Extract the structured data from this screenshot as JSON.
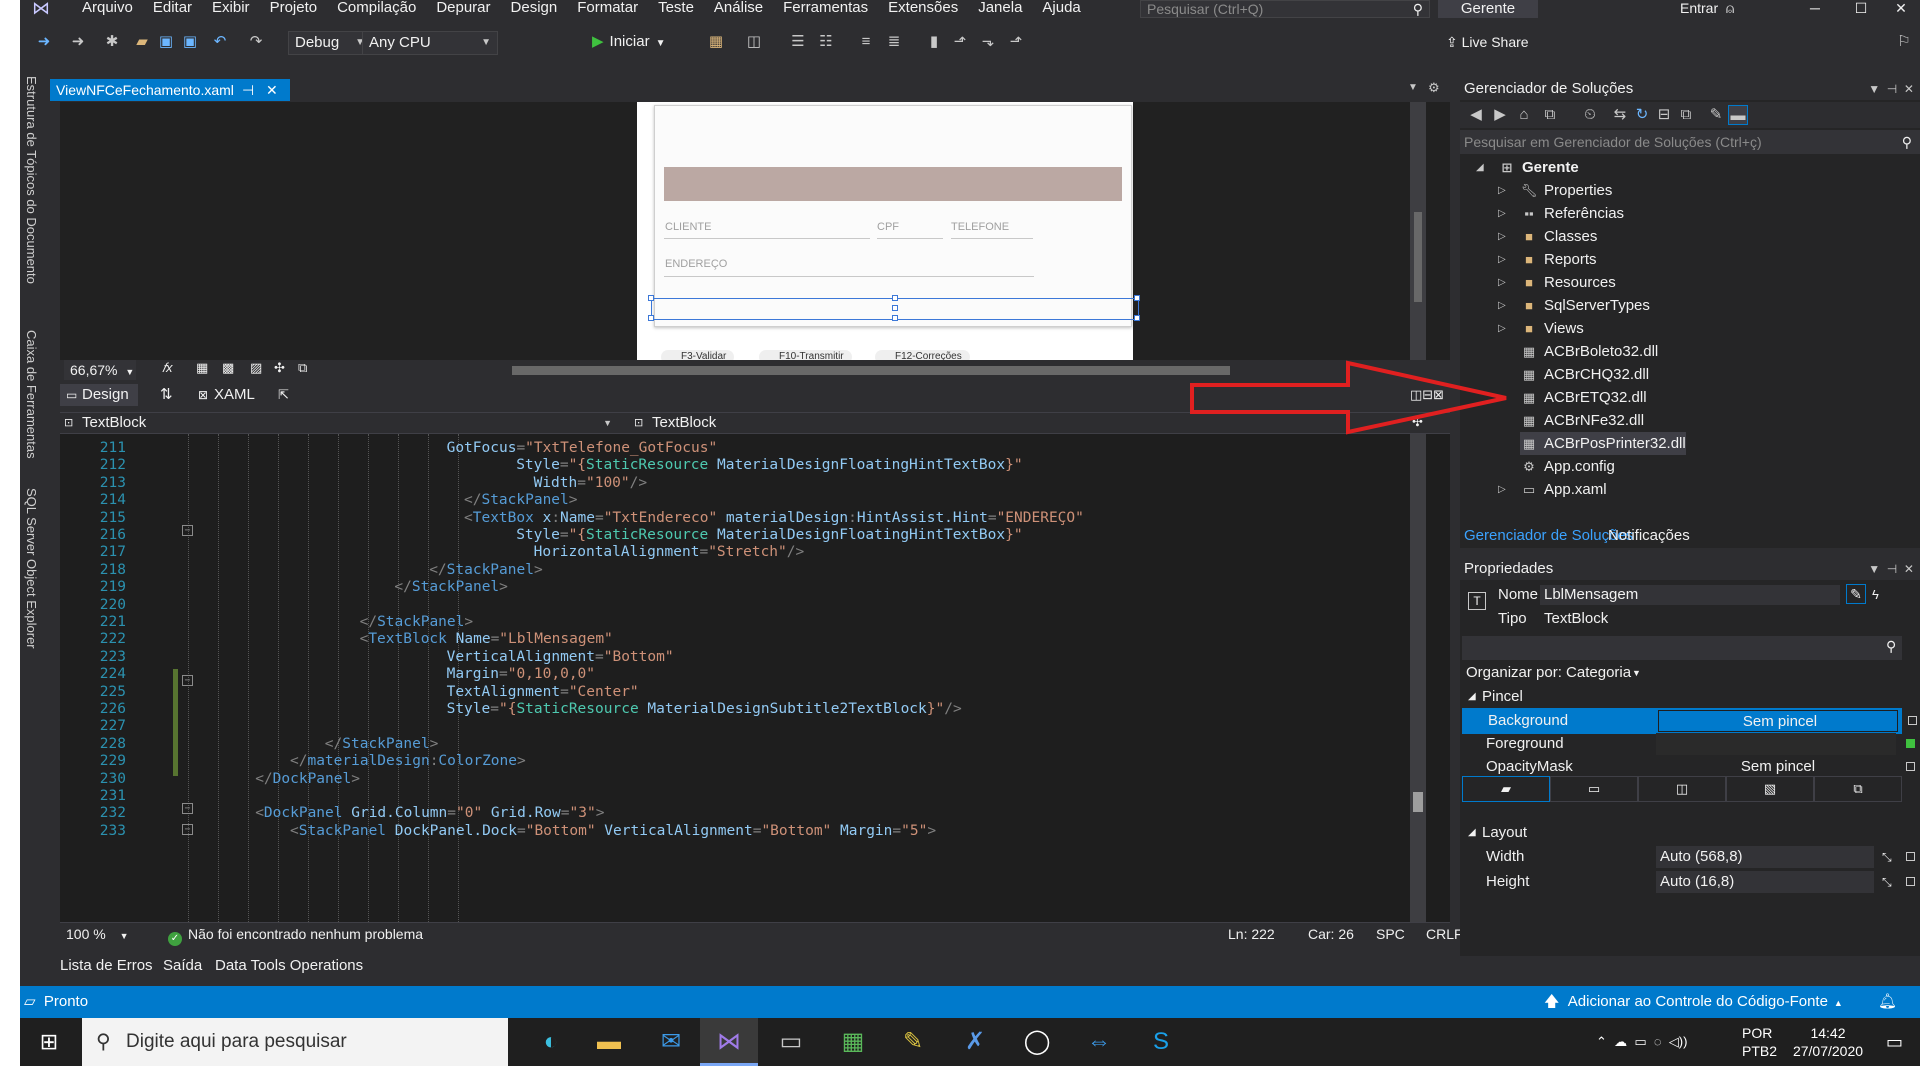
{
  "menu": {
    "items": [
      "Arquivo",
      "Editar",
      "Exibir",
      "Projeto",
      "Compilação",
      "Depurar",
      "Design",
      "Formatar",
      "Teste",
      "Análise",
      "Ferramentas",
      "Extensões",
      "Janela",
      "Ajuda"
    ],
    "search_placeholder": "Pesquisar (Ctrl+Q)",
    "solution_name": "Gerente",
    "sign_in": "Entrar"
  },
  "toolbar": {
    "config": "Debug",
    "platform": "Any CPU",
    "start_label": "Iniciar",
    "live_share": "Live Share"
  },
  "side_tabs": [
    "Estrutura de Tópicos do Documento",
    "Caixa de Ferramentas",
    "SQL Server Object Explorer"
  ],
  "document_tab": {
    "title": "ViewNFCeFechamento.xaml"
  },
  "designer": {
    "fields": {
      "cliente": "CLIENTE",
      "cpf": "CPF",
      "telefone": "TELEFONE",
      "endereco": "ENDEREÇO"
    },
    "buttons": [
      "F3-Validar",
      "F10-Transmitir",
      "F12-Correções"
    ],
    "zoom": "66,67%"
  },
  "split_tabs": {
    "design": "Design",
    "xaml": "XAML"
  },
  "breadcrumb": {
    "left": "TextBlock",
    "right": "TextBlock"
  },
  "code_lines": [
    {
      "n": "211",
      "indent": 38,
      "parts": [
        [
          "attr",
          "GotFocus"
        ],
        [
          "br",
          "="
        ],
        [
          "str",
          "\"TxtTelefone_GotFocus\""
        ]
      ]
    },
    {
      "n": "212",
      "indent": 46,
      "parts": [
        [
          "attr",
          "Style"
        ],
        [
          "br",
          "="
        ],
        [
          "str",
          "\"{"
        ],
        [
          "res",
          "StaticResource "
        ],
        [
          "attr",
          "MaterialDesignFloatingHintTextBox"
        ],
        [
          "str",
          "}\""
        ]
      ]
    },
    {
      "n": "213",
      "indent": 48,
      "parts": [
        [
          "attr",
          "Width"
        ],
        [
          "br",
          "="
        ],
        [
          "str",
          "\"100\""
        ],
        [
          "br",
          "/>"
        ]
      ]
    },
    {
      "n": "214",
      "indent": 40,
      "parts": [
        [
          "br",
          "</"
        ],
        [
          "tag",
          "StackPanel"
        ],
        [
          "br",
          ">"
        ]
      ]
    },
    {
      "n": "215",
      "indent": 40,
      "parts": [
        [
          "br",
          "<"
        ],
        [
          "tag",
          "TextBox "
        ],
        [
          "attr",
          "x"
        ],
        [
          "br",
          ":"
        ],
        [
          "attr",
          "Name"
        ],
        [
          "br",
          "="
        ],
        [
          "str",
          "\"TxtEndereco\" "
        ],
        [
          "attr",
          "materialDesign"
        ],
        [
          "br",
          ":"
        ],
        [
          "attr",
          "HintAssist.Hint"
        ],
        [
          "br",
          "="
        ],
        [
          "str",
          "\"ENDEREÇO\""
        ]
      ]
    },
    {
      "n": "216",
      "indent": 46,
      "parts": [
        [
          "attr",
          "Style"
        ],
        [
          "br",
          "="
        ],
        [
          "str",
          "\"{"
        ],
        [
          "res",
          "StaticResource "
        ],
        [
          "attr",
          "MaterialDesignFloatingHintTextBox"
        ],
        [
          "str",
          "}\""
        ]
      ]
    },
    {
      "n": "217",
      "indent": 48,
      "parts": [
        [
          "attr",
          "HorizontalAlignment"
        ],
        [
          "br",
          "="
        ],
        [
          "str",
          "\"Stretch\""
        ],
        [
          "br",
          "/>"
        ]
      ]
    },
    {
      "n": "218",
      "indent": 36,
      "parts": [
        [
          "br",
          "</"
        ],
        [
          "tag",
          "StackPanel"
        ],
        [
          "br",
          ">"
        ]
      ]
    },
    {
      "n": "219",
      "indent": 32,
      "parts": [
        [
          "br",
          "</"
        ],
        [
          "tag",
          "StackPanel"
        ],
        [
          "br",
          ">"
        ]
      ]
    },
    {
      "n": "220",
      "indent": 0,
      "parts": []
    },
    {
      "n": "221",
      "indent": 28,
      "parts": [
        [
          "br",
          "</"
        ],
        [
          "tag",
          "StackPanel"
        ],
        [
          "br",
          ">"
        ]
      ]
    },
    {
      "n": "222",
      "indent": 28,
      "parts": [
        [
          "br",
          "<"
        ],
        [
          "tag",
          "TextBlock "
        ],
        [
          "attr",
          "Name"
        ],
        [
          "br",
          "="
        ],
        [
          "str",
          "\"LblMensagem\""
        ]
      ]
    },
    {
      "n": "223",
      "indent": 38,
      "parts": [
        [
          "attr",
          "VerticalAlignment"
        ],
        [
          "br",
          "="
        ],
        [
          "str",
          "\"Bottom\""
        ]
      ]
    },
    {
      "n": "224",
      "indent": 38,
      "parts": [
        [
          "attr",
          "Margin"
        ],
        [
          "br",
          "="
        ],
        [
          "str",
          "\"0,10,0,0\""
        ]
      ]
    },
    {
      "n": "225",
      "indent": 38,
      "parts": [
        [
          "attr",
          "TextAlignment"
        ],
        [
          "br",
          "="
        ],
        [
          "str",
          "\"Center\""
        ]
      ]
    },
    {
      "n": "226",
      "indent": 38,
      "parts": [
        [
          "attr",
          "Style"
        ],
        [
          "br",
          "="
        ],
        [
          "str",
          "\"{"
        ],
        [
          "res",
          "StaticResource "
        ],
        [
          "attr",
          "MaterialDesignSubtitle2TextBlock"
        ],
        [
          "str",
          "}\""
        ],
        [
          "br",
          "/>"
        ]
      ]
    },
    {
      "n": "227",
      "indent": 0,
      "parts": []
    },
    {
      "n": "228",
      "indent": 24,
      "parts": [
        [
          "br",
          "</"
        ],
        [
          "tag",
          "StackPanel"
        ],
        [
          "br",
          ">"
        ]
      ]
    },
    {
      "n": "229",
      "indent": 20,
      "parts": [
        [
          "br",
          "</"
        ],
        [
          "tag",
          "materialDesign"
        ],
        [
          "br",
          ":"
        ],
        [
          "tag",
          "ColorZone"
        ],
        [
          "br",
          ">"
        ]
      ]
    },
    {
      "n": "230",
      "indent": 16,
      "parts": [
        [
          "br",
          "</"
        ],
        [
          "tag",
          "DockPanel"
        ],
        [
          "br",
          ">"
        ]
      ]
    },
    {
      "n": "231",
      "indent": 0,
      "parts": []
    },
    {
      "n": "232",
      "indent": 16,
      "parts": [
        [
          "br",
          "<"
        ],
        [
          "tag",
          "DockPanel "
        ],
        [
          "attr",
          "Grid.Column"
        ],
        [
          "br",
          "="
        ],
        [
          "str",
          "\"0\" "
        ],
        [
          "attr",
          "Grid.Row"
        ],
        [
          "br",
          "="
        ],
        [
          "str",
          "\"3\""
        ],
        [
          "br",
          ">"
        ]
      ]
    },
    {
      "n": "233",
      "indent": 20,
      "parts": [
        [
          "br",
          "<"
        ],
        [
          "tag",
          "StackPanel "
        ],
        [
          "attr",
          "DockPanel.Dock"
        ],
        [
          "br",
          "="
        ],
        [
          "str",
          "\"Bottom\" "
        ],
        [
          "attr",
          "VerticalAlignment"
        ],
        [
          "br",
          "="
        ],
        [
          "str",
          "\"Bottom\" "
        ],
        [
          "attr",
          "Margin"
        ],
        [
          "br",
          "="
        ],
        [
          "str",
          "\"5\""
        ],
        [
          "br",
          ">"
        ]
      ]
    }
  ],
  "editor_status": {
    "zoom": "100 %",
    "issues": "Não foi encontrado nenhum problema",
    "line": "Ln: 222",
    "col": "Car: 26",
    "spc": "SPC",
    "crlf": "CRLF"
  },
  "bottom_tabs": [
    "Lista de Erros",
    "Saída",
    "Data Tools Operations"
  ],
  "status_bar": {
    "ready": "Pronto",
    "source_control": "Adicionar ao Controle do Código-Fonte"
  },
  "solution_explorer": {
    "title": "Gerenciador de Soluções",
    "search_placeholder": "Pesquisar em Gerenciador de Soluções (Ctrl+ç)",
    "project": "Gerente",
    "items": [
      {
        "label": "Properties",
        "icon": "wrench",
        "expandable": true
      },
      {
        "label": "Referências",
        "icon": "references",
        "expandable": true
      },
      {
        "label": "Classes",
        "icon": "folder",
        "expandable": true
      },
      {
        "label": "Reports",
        "icon": "folder",
        "expandable": true
      },
      {
        "label": "Resources",
        "icon": "folder",
        "expandable": true
      },
      {
        "label": "SqlServerTypes",
        "icon": "folder",
        "expandable": true
      },
      {
        "label": "Views",
        "icon": "folder",
        "expandable": true
      },
      {
        "label": "ACBrBoleto32.dll",
        "icon": "dll",
        "expandable": false
      },
      {
        "label": "ACBrCHQ32.dll",
        "icon": "dll",
        "expandable": false
      },
      {
        "label": "ACBrETQ32.dll",
        "icon": "dll",
        "expandable": false
      },
      {
        "label": "ACBrNFe32.dll",
        "icon": "dll",
        "expandable": false
      },
      {
        "label": "ACBrPosPrinter32.dll",
        "icon": "dll",
        "expandable": false
      },
      {
        "label": "App.config",
        "icon": "config",
        "expandable": false
      },
      {
        "label": "App.xaml",
        "icon": "xaml",
        "expandable": true
      }
    ],
    "tabs": [
      "Gerenciador de Soluções",
      "Notificações"
    ]
  },
  "properties": {
    "title": "Propriedades",
    "name_label": "Nome",
    "name_value": "LblMensagem",
    "type_label": "Tipo",
    "type_value": "TextBlock",
    "arrange_by": "Organizar por: Categoria",
    "brush_category": "Pincel",
    "brush_rows": [
      {
        "name": "Background",
        "value": "Sem pincel"
      },
      {
        "name": "Foreground",
        "value": ""
      },
      {
        "name": "OpacityMask",
        "value": "Sem pincel"
      }
    ],
    "layout_category": "Layout",
    "layout_rows": [
      {
        "name": "Width",
        "value": "Auto (568,8)"
      },
      {
        "name": "Height",
        "value": "Auto (16,8)"
      }
    ]
  },
  "taskbar": {
    "search_placeholder": "Digite aqui para pesquisar",
    "lang": "POR",
    "layout": "PTB2",
    "time": "14:42",
    "date": "27/07/2020"
  },
  "colors": {
    "accent": "#007acc",
    "arrow": "#e02020",
    "editor_bg": "#1e1e1e"
  }
}
